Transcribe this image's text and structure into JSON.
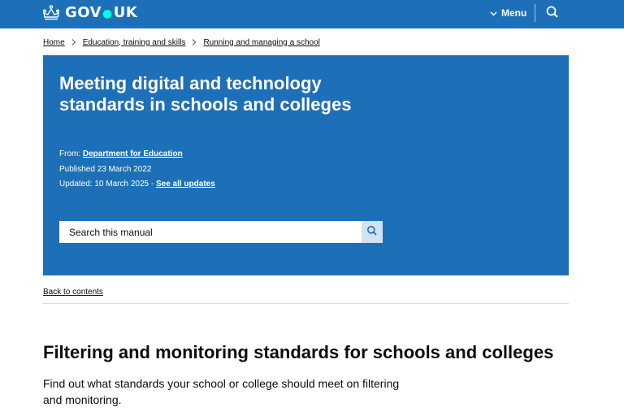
{
  "header": {
    "logo_text": "GOV",
    "logo_text2": "UK",
    "menu_label": "Menu",
    "search_icon": "search-icon",
    "crown_icon": "crown-icon"
  },
  "breadcrumb": {
    "items": [
      "Home",
      "Education, training and skills",
      "Running and managing a school"
    ]
  },
  "hero": {
    "title": "Meeting digital and technology standards in schools and colleges",
    "from_label": "From:",
    "from_link": "Department for Education",
    "published": "Published 23 March 2022",
    "updated": "Updated: 10 March 2025 - ",
    "see_all_updates": "See all updates",
    "search_placeholder": "Search this manual"
  },
  "back_link": "Back to contents",
  "page": {
    "heading": "Filtering and monitoring standards for schools and colleges",
    "lede": "Find out what standards your school or college should meet on filtering and monitoring."
  },
  "colors": {
    "brand_blue": "#1d70b8",
    "text": "#0b0c0c",
    "search_button_bg": "#d2e2f1"
  }
}
